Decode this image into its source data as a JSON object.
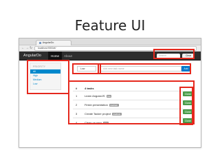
{
  "slide": {
    "title": "Feature UI"
  },
  "browser": {
    "tab_title": "AngularDo",
    "url": "localhost:9000/#/",
    "back_icon": "arrow-left-icon",
    "forward_icon": "arrow-right-icon",
    "reload_icon": "reload-icon"
  },
  "navbar": {
    "brand": "AngularDo",
    "home_label": "Home",
    "about_label": "About",
    "search_placeholder": "Search",
    "clear_label": "Clear"
  },
  "sidebar": {
    "header": "PRIORITY",
    "items": [
      {
        "label": "All",
        "active": true
      },
      {
        "label": "High",
        "active": false
      },
      {
        "label": "Medium",
        "active": false
      },
      {
        "label": "Low",
        "active": false
      }
    ]
  },
  "new_task": {
    "priority_value": "Low",
    "placeholder": "Add new task name",
    "add_label": "Add"
  },
  "tasks": {
    "count_label": "#",
    "header": "4 tasks",
    "rows": [
      {
        "num": "1",
        "name": "Learn AngularJS",
        "tag": "low",
        "done_label": "Done"
      },
      {
        "num": "2",
        "name": "Finish presentation",
        "tag": "medium",
        "done_label": "Done"
      },
      {
        "num": "3",
        "name": "Create Tacker project",
        "tag": "medium",
        "done_label": "Done"
      },
      {
        "num": "4",
        "name": "Clean up repo",
        "tag": "low",
        "done_label": "Done"
      }
    ]
  },
  "colors": {
    "highlight": "#e5281d",
    "primary": "#0077cc",
    "success": "#51a351",
    "navbar": "#2d2d2d"
  }
}
